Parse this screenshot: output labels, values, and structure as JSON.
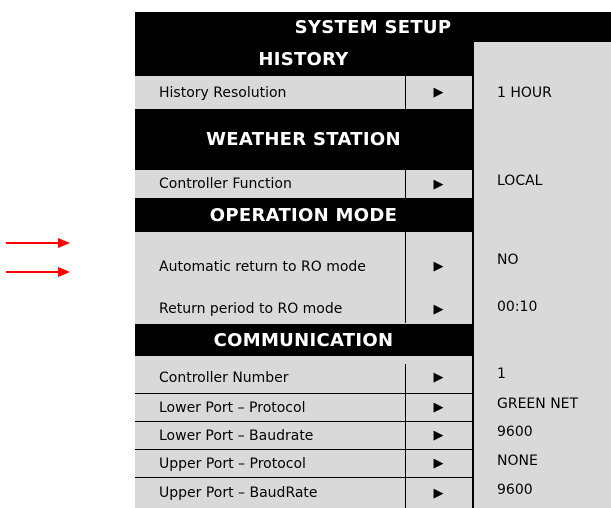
{
  "title": "SYSTEM SETUP",
  "sections": [
    {
      "header": "HISTORY",
      "rows": [
        {
          "label": "History Resolution",
          "value": "1 HOUR"
        }
      ]
    },
    {
      "header": "WEATHER STATION",
      "rows": [
        {
          "label": "Controller Function",
          "value": "LOCAL"
        }
      ]
    },
    {
      "header": "OPERATION MODE",
      "rows": [
        {
          "label": "Automatic return to RO mode",
          "value": "NO"
        },
        {
          "label": "Return period to RO mode",
          "value": "00:10"
        }
      ]
    },
    {
      "header": "COMMUNICATION",
      "rows": [
        {
          "label": "Controller Number",
          "value": "1"
        },
        {
          "label": "Lower Port – Protocol",
          "value": "GREEN NET"
        },
        {
          "label": "Lower Port – Baudrate",
          "value": "9600"
        },
        {
          "label": "Upper Port – Protocol",
          "value": "NONE"
        },
        {
          "label": "Upper Port – BaudRate",
          "value": "9600"
        }
      ]
    }
  ],
  "arrow_glyph": "▶",
  "icons": {
    "row_arrow": "right-triangle-icon",
    "annotation": "red-right-arrow-icon"
  },
  "colors": {
    "header_bg": "#000000",
    "panel_bg": "#d9d9d9",
    "annotation": "#ff0000"
  }
}
